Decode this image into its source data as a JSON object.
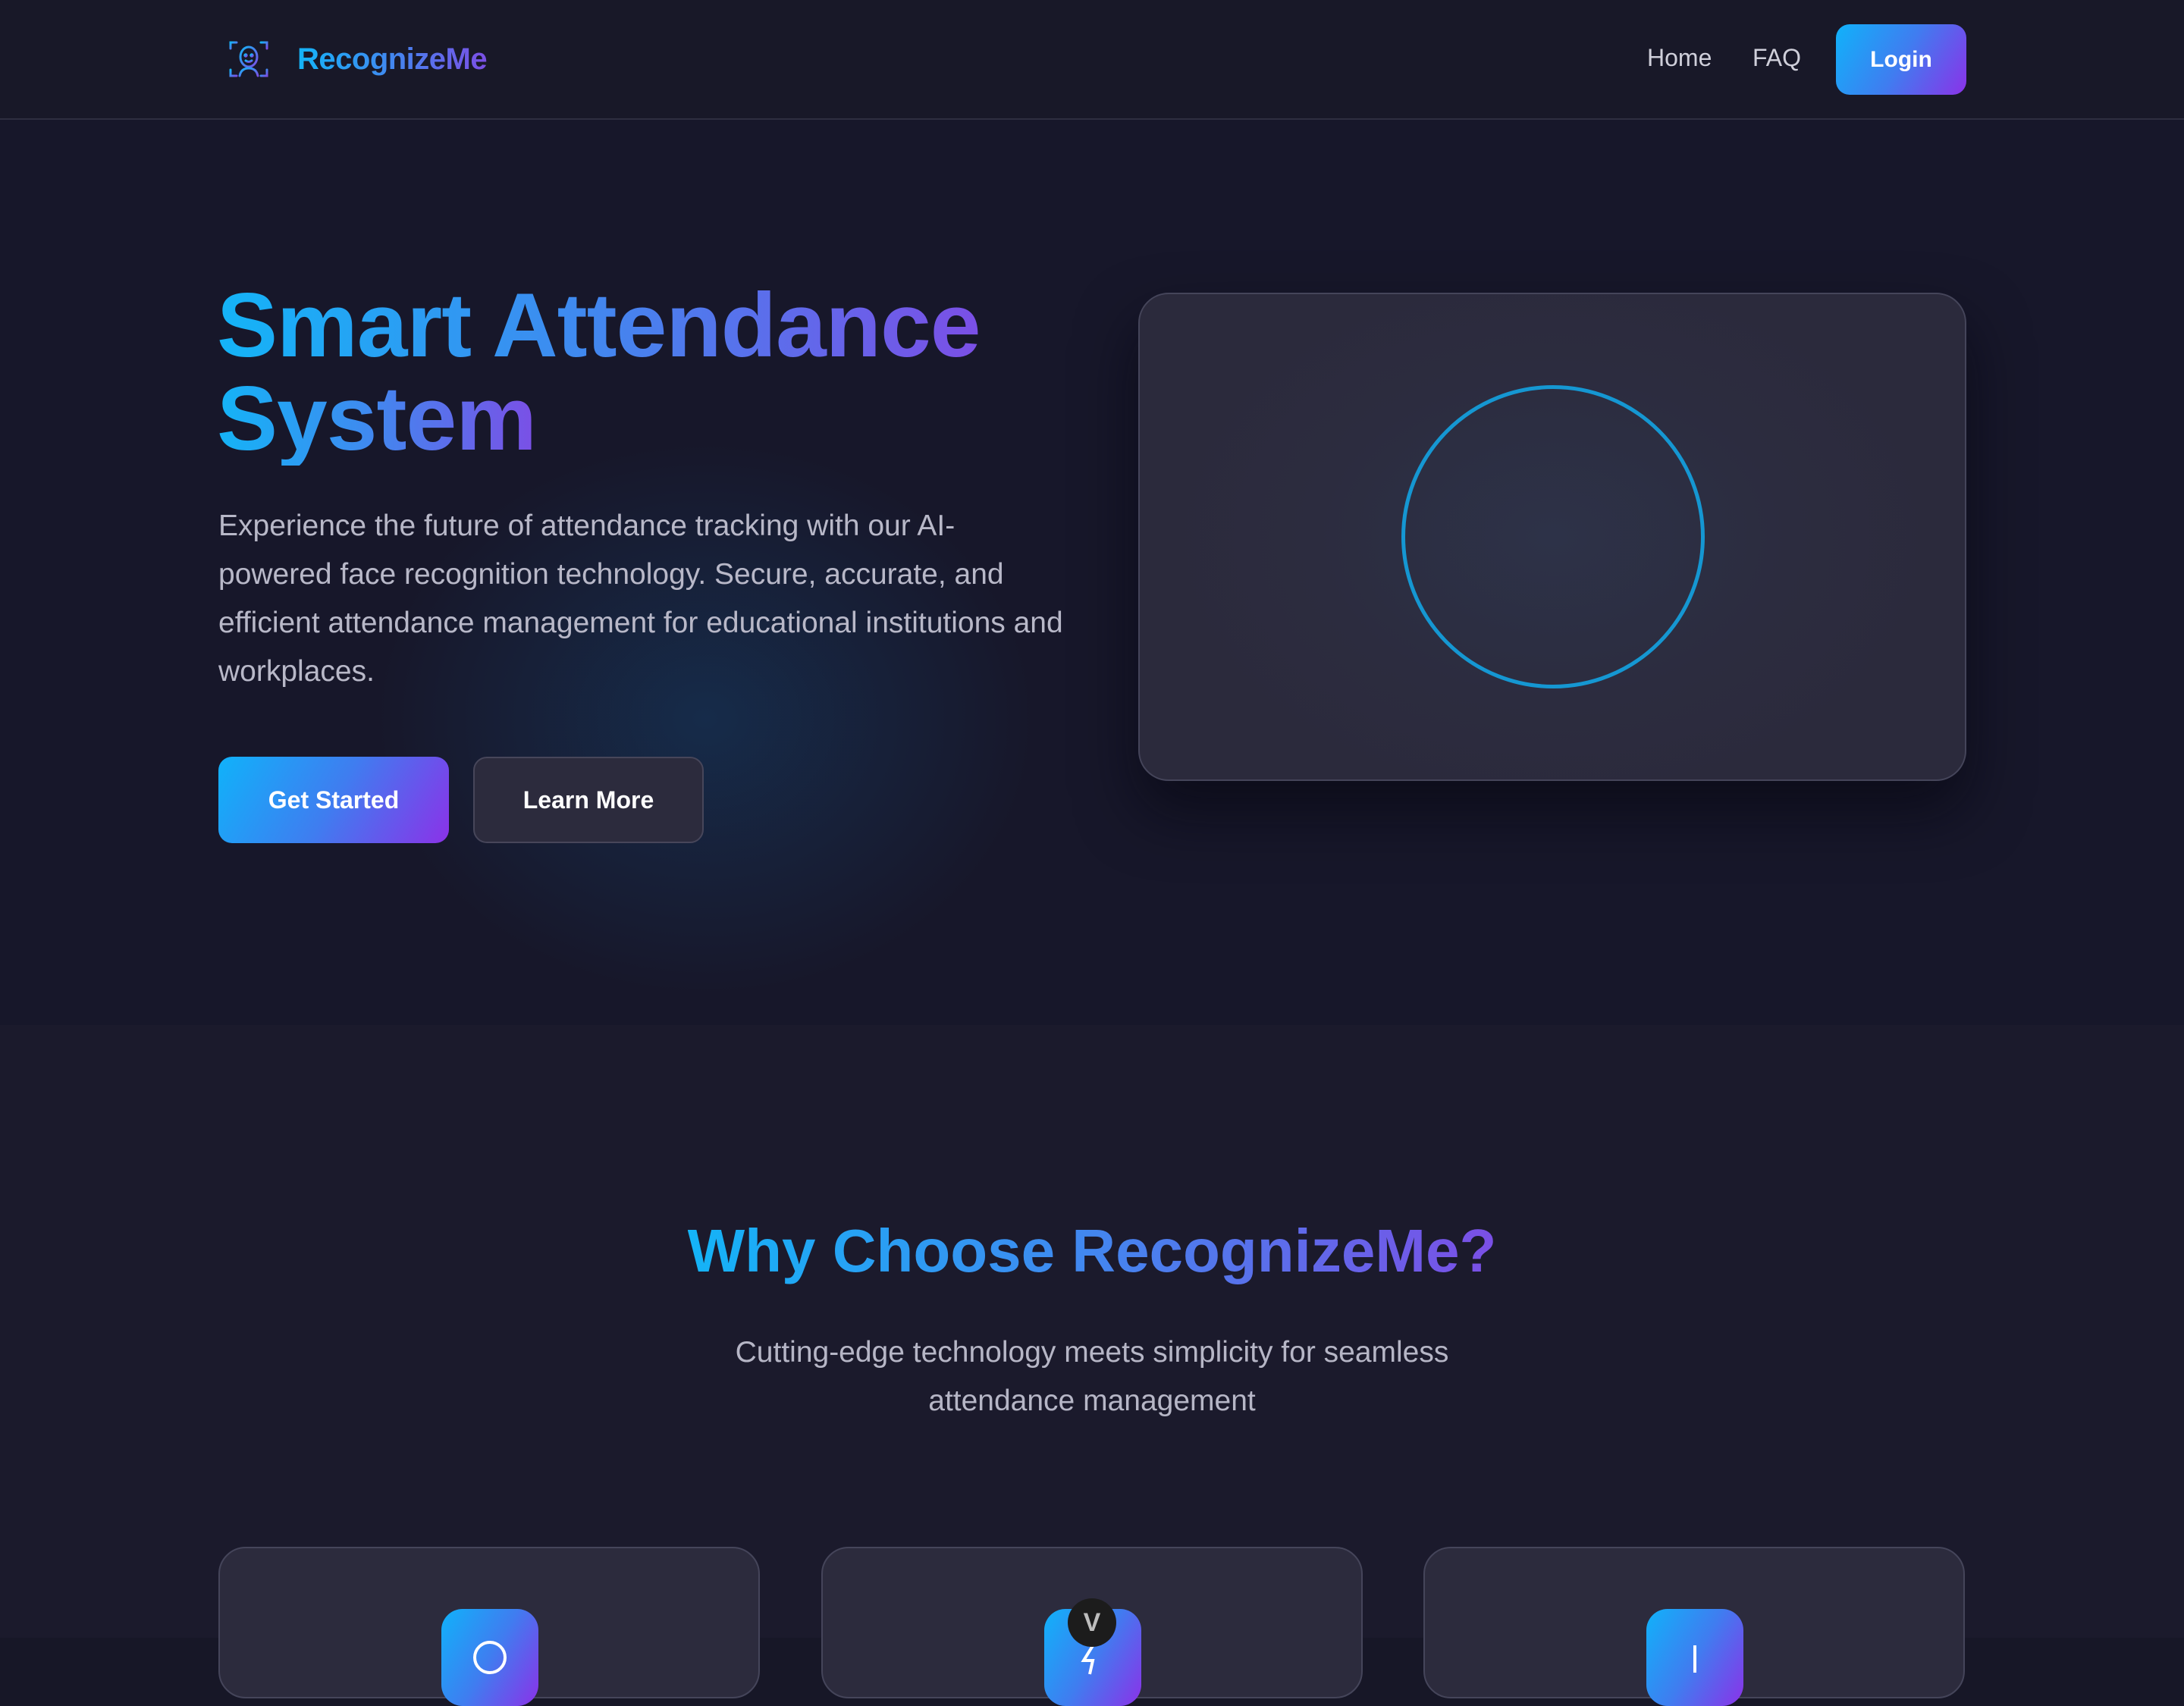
{
  "nav": {
    "brand": "RecognizeMe",
    "logo_icon": "face-scan-icon",
    "links": [
      {
        "label": "Home"
      },
      {
        "label": "FAQ"
      }
    ],
    "login_label": "Login"
  },
  "hero": {
    "title_line1": "Smart Attendance",
    "title_line2": "System",
    "description": "Experience the future of attendance tracking with our AI-powered face recognition technology. Secure, accurate, and efficient attendance management for educational institutions and workplaces.",
    "primary_cta": "Get Started",
    "secondary_cta": "Learn More",
    "visual_icon": "face-scan-ring-icon"
  },
  "features": {
    "title": "Why Choose RecognizeMe?",
    "subtitle": "Cutting-edge technology meets simplicity for seamless attendance management",
    "cards": [
      {
        "icon": "shield-icon"
      },
      {
        "icon": "lightning-icon"
      },
      {
        "icon": "check-icon"
      }
    ]
  },
  "floating_badge": {
    "icon": "chevron-down-icon",
    "label": "V"
  },
  "colors": {
    "accent_start": "#10b2fa",
    "accent_mid": "#3f7df0",
    "accent_end": "#8b32e8",
    "background": "#171727",
    "card": "#2c2b3d",
    "ring": "#1597d2"
  }
}
